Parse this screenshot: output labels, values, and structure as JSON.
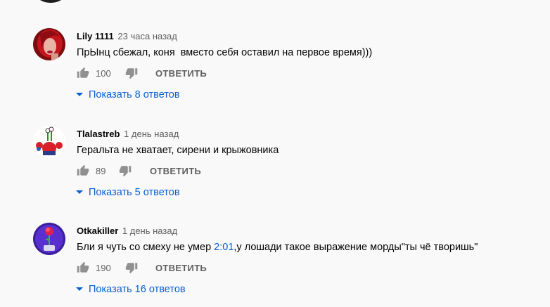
{
  "comments": [
    {
      "author": "Lily 1111",
      "time": "23 часа назад",
      "text": "ПрЫнц сбежал, коня  вместо себя оставил на первое время)))",
      "likes": "100",
      "reply_label": "ОТВЕТИТЬ",
      "show_replies": "Показать 8 ответов",
      "avatar_icon": "woman-portrait-avatar"
    },
    {
      "author": "Tlalastreb",
      "time": "1 день назад",
      "text": "Геральта не хватает, сирени и крыжовника",
      "likes": "89",
      "reply_label": "ОТВЕТИТЬ",
      "show_replies": "Показать 5 ответов",
      "avatar_icon": "cartoon-crab-avatar"
    },
    {
      "author": "Otkakiller",
      "time": "1 день назад",
      "text_before": "Бли я чуть со смеху не умер ",
      "timestamp": "2:01",
      "text_after": ",у лошади такое выражение морды\"ты чё творишь\"",
      "likes": "190",
      "reply_label": "ОТВЕТИТЬ",
      "show_replies": "Показать 16 ответов",
      "avatar_icon": "rose-art-avatar"
    }
  ],
  "colors": {
    "background": "#f9f9f9",
    "link": "#065fd4",
    "secondary_text": "#606060",
    "primary_text": "#030303"
  },
  "icons": {
    "like": "thumb-up-icon",
    "dislike": "thumb-down-icon",
    "expand": "caret-down-icon"
  }
}
